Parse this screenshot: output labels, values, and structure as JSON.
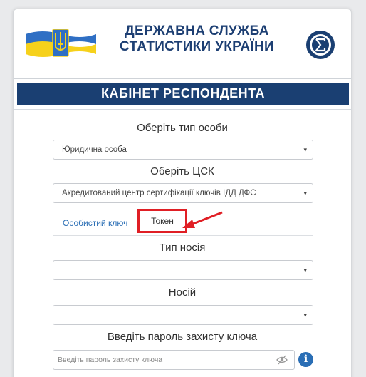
{
  "header": {
    "agency_line1": "ДЕРЖАВНА СЛУЖБА",
    "agency_line2": "СТАТИСТИКИ УКРАЇНИ",
    "logo_icon": "ukraine-flag-trident-icon",
    "emblem_icon": "sigma-emblem-icon"
  },
  "banner": {
    "title": "КАБІНЕТ РЕСПОНДЕНТА"
  },
  "form": {
    "person_type": {
      "label": "Оберіть тип особи",
      "value": "Юридична особа"
    },
    "csk": {
      "label": "Оберіть ЦСК",
      "value": "Акредитований центр сертифікації ключів ІДД ДФС"
    },
    "tabs": {
      "personal_key": "Особистий ключ",
      "token": "Токен"
    },
    "media_type": {
      "label": "Тип носія",
      "value": ""
    },
    "media": {
      "label": "Носій",
      "value": ""
    },
    "password": {
      "label": "Введіть пароль захисту ключа",
      "placeholder": "Введіть пароль захисту ключа"
    }
  },
  "colors": {
    "brand_blue": "#1a3f72",
    "highlight_red": "#e01f25",
    "link_blue": "#2a6eb5"
  },
  "icons": {
    "caret": "▾",
    "info": "i"
  }
}
